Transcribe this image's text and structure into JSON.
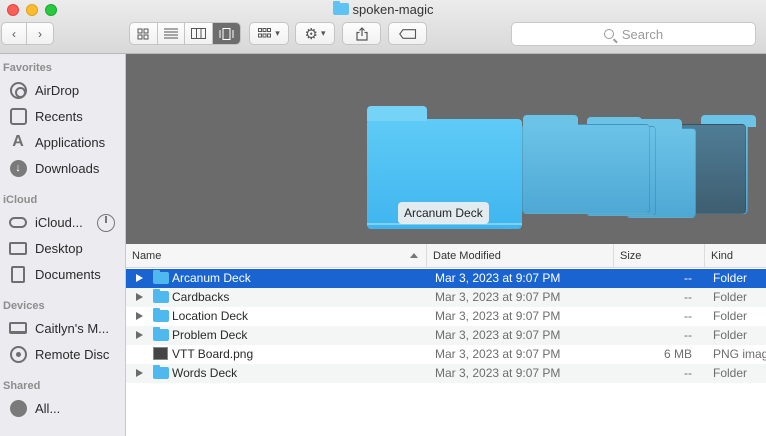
{
  "window": {
    "title": "spoken-magic",
    "folder_icon": "folder-icon"
  },
  "toolbar": {
    "back_icon": "‹",
    "forward_icon": "›",
    "view_modes": [
      "icon-view",
      "list-view",
      "column-view",
      "cover-flow-view"
    ],
    "active_view": "cover-flow-view",
    "search_placeholder": "Search"
  },
  "sidebar": {
    "sections": [
      {
        "title": "Favorites",
        "items": [
          {
            "label": "AirDrop",
            "icon": "airdrop-icon"
          },
          {
            "label": "Recents",
            "icon": "recents-icon"
          },
          {
            "label": "Applications",
            "icon": "applications-icon"
          },
          {
            "label": "Downloads",
            "icon": "downloads-icon"
          }
        ]
      },
      {
        "title": "iCloud",
        "items": [
          {
            "label": "iCloud...",
            "icon": "icloud-icon"
          },
          {
            "label": "Desktop",
            "icon": "desktop-icon"
          },
          {
            "label": "Documents",
            "icon": "documents-icon"
          }
        ]
      },
      {
        "title": "Devices",
        "items": [
          {
            "label": "Caitlyn's M...",
            "icon": "laptop-icon"
          },
          {
            "label": "Remote Disc",
            "icon": "disc-icon"
          }
        ]
      },
      {
        "title": "Shared",
        "items": [
          {
            "label": "All...",
            "icon": "network-icon"
          }
        ]
      }
    ]
  },
  "preview": {
    "label": "Arcanum Deck"
  },
  "list": {
    "columns": {
      "name": "Name",
      "date": "Date Modified",
      "size": "Size",
      "kind": "Kind"
    },
    "rows": [
      {
        "name": "Arcanum Deck",
        "date": "Mar 3, 2023 at 9:07 PM",
        "size": "--",
        "kind": "Folder",
        "type": "folder",
        "selected": true
      },
      {
        "name": "Cardbacks",
        "date": "Mar 3, 2023 at 9:07 PM",
        "size": "--",
        "kind": "Folder",
        "type": "folder",
        "selected": false
      },
      {
        "name": "Location Deck",
        "date": "Mar 3, 2023 at 9:07 PM",
        "size": "--",
        "kind": "Folder",
        "type": "folder",
        "selected": false
      },
      {
        "name": "Problem Deck",
        "date": "Mar 3, 2023 at 9:07 PM",
        "size": "--",
        "kind": "Folder",
        "type": "folder",
        "selected": false
      },
      {
        "name": "VTT Board.png",
        "date": "Mar 3, 2023 at 9:07 PM",
        "size": "6 MB",
        "kind": "PNG image",
        "type": "image",
        "selected": false
      },
      {
        "name": "Words Deck",
        "date": "Mar 3, 2023 at 9:07 PM",
        "size": "--",
        "kind": "Folder",
        "type": "folder",
        "selected": false
      }
    ]
  },
  "colors": {
    "selection": "#1a64d2",
    "folder": "#4fb8ef"
  }
}
